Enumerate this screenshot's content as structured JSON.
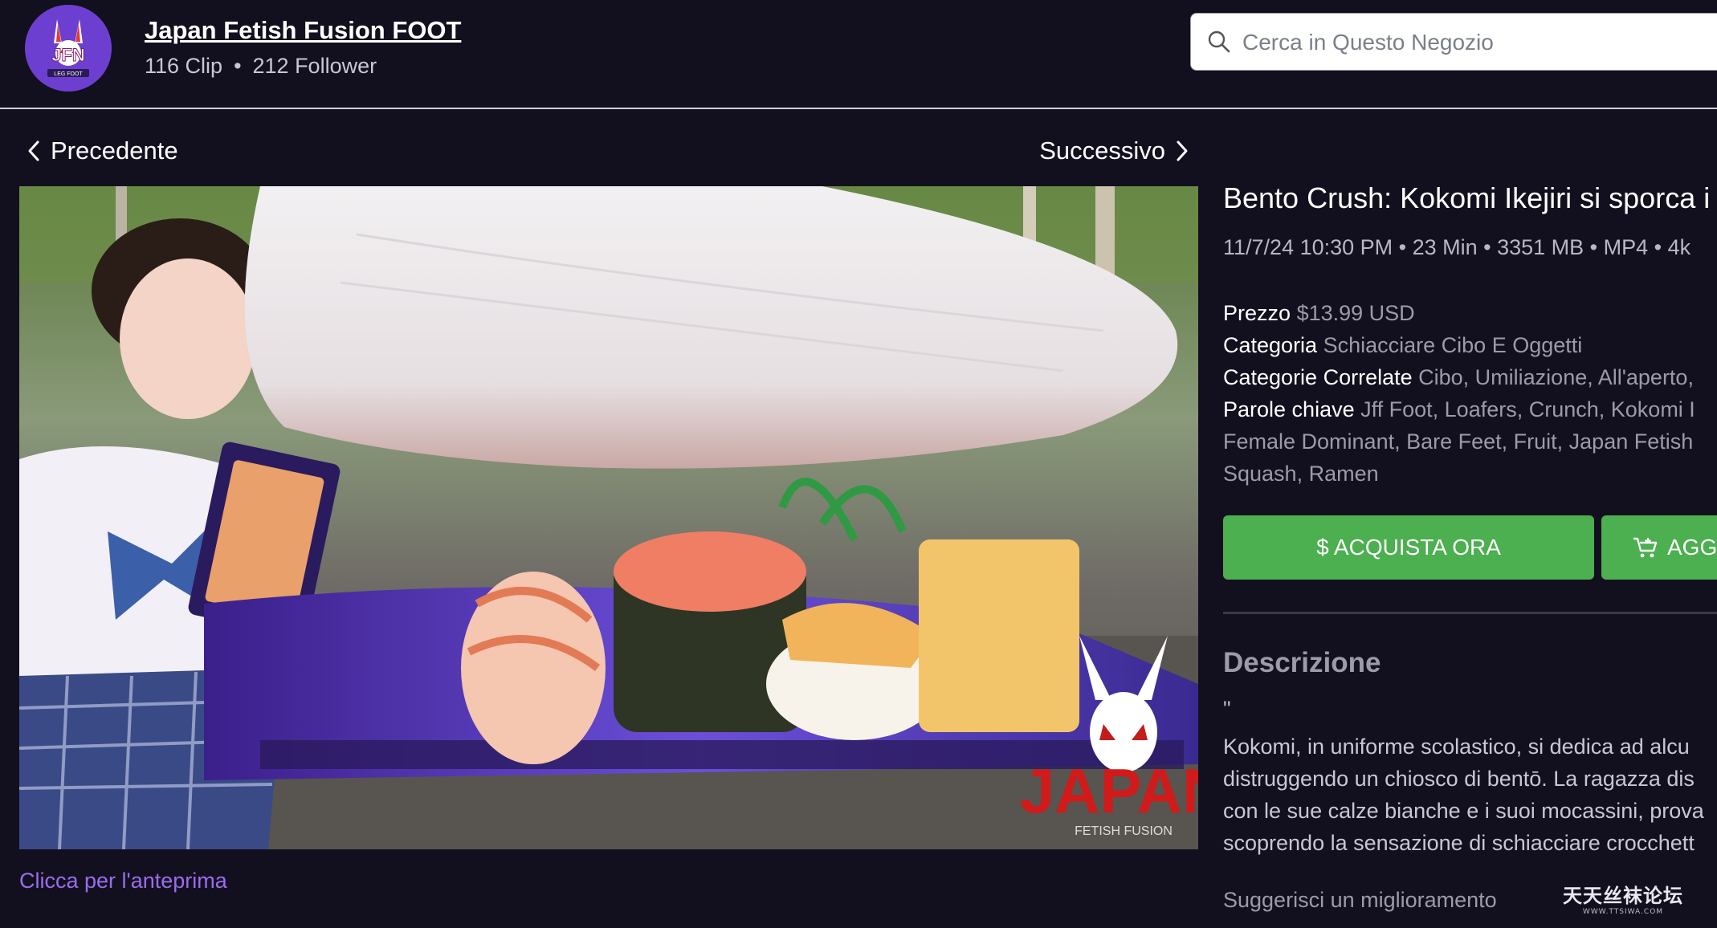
{
  "store": {
    "name": "Japan Fetish Fusion FOOT",
    "clips": "116 Clip",
    "separator": "•",
    "followers": "212 Follower",
    "avatar_logo_text": "JFN",
    "avatar_logo_sub": "LEG FOOT"
  },
  "search": {
    "placeholder": "Cerca in Questo Negozio",
    "icon": "search-icon"
  },
  "nav": {
    "prev_label": "Precedente",
    "next_label": "Successivo"
  },
  "preview": {
    "link_label": "Clicca per l'anteprima",
    "watermark_brand": "JAPAN",
    "watermark_sub": "FETISH FUSION"
  },
  "clip": {
    "title": "Bento Crush: Kokomi Ikejiri si sporca i",
    "meta": "11/7/24 10:30 PM • 23 Min • 3351 MB • MP4 • 4k",
    "price_label": "Prezzo",
    "price_value": "$13.99 USD",
    "category_label": "Categoria",
    "category_value": "Schiacciare Cibo E Oggetti",
    "related_label": "Categorie Correlate",
    "related_value": "Cibo, Umiliazione, All'aperto,",
    "keywords_label": "Parole chiave",
    "keywords_line1": "Jff Foot, Loafers, Crunch, Kokomi I",
    "keywords_line2": "Female Dominant, Bare Feet, Fruit, Japan Fetish",
    "keywords_line3": "Squash, Ramen"
  },
  "actions": {
    "buy_label": "$ ACQUISTA ORA",
    "cart_label": "AGG",
    "accent_color": "#4caf50"
  },
  "description": {
    "heading": "Descrizione",
    "quote": "\"",
    "lines": [
      "Kokomi, in uniforme scolastico, si dedica ad alcu",
      "distruggendo un chiosco di bentō. La ragazza dis",
      "con le sue calze bianche e i suoi mocassini, prova",
      "scoprendo la sensazione di schiacciare crocchett"
    ],
    "suggest": "Suggerisci un miglioramento"
  },
  "watermark": {
    "line1": "天天丝袜论坛",
    "line2": "WWW.TTSIWA.COM"
  },
  "colors": {
    "background": "#12101e",
    "link": "#9b6cf0",
    "muted": "#9d9aa9"
  }
}
